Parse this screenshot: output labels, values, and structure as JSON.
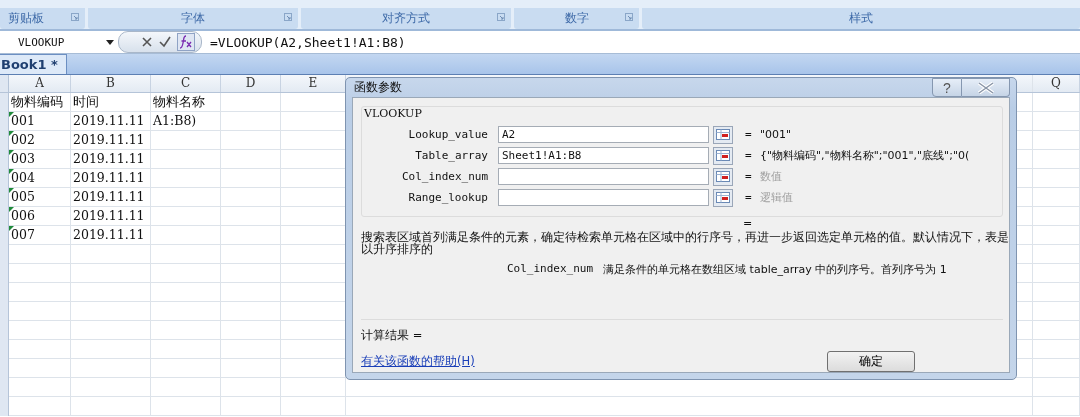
{
  "ribbon": {
    "groups": [
      {
        "label": "剪贴板",
        "launcher": true
      },
      {
        "label": "字体",
        "launcher": true
      },
      {
        "label": "对齐方式",
        "launcher": true
      },
      {
        "label": "数字",
        "launcher": true
      },
      {
        "label": "样式",
        "launcher": false
      }
    ]
  },
  "formula_bar": {
    "name_box": "VLOOKUP",
    "formula": "=VLOOKUP(A2,Sheet1!A1:B8)"
  },
  "workbook_tabs": [
    {
      "label": "Book1 *",
      "selected": true
    }
  ],
  "sheet": {
    "columns": [
      "A",
      "B",
      "C",
      "D",
      "E",
      "Q"
    ],
    "rows": [
      {
        "cells": [
          "物料编码",
          "时间",
          "物料名称"
        ],
        "flagged": false
      },
      {
        "cells": [
          "001",
          "2019.11.11",
          "A1:B8)"
        ],
        "flagged": true
      },
      {
        "cells": [
          "002",
          "2019.11.11"
        ],
        "flagged": true
      },
      {
        "cells": [
          "003",
          "2019.11.11"
        ],
        "flagged": true
      },
      {
        "cells": [
          "004",
          "2019.11.11"
        ],
        "flagged": true
      },
      {
        "cells": [
          "005",
          "2019.11.11"
        ],
        "flagged": true
      },
      {
        "cells": [
          "006",
          "2019.11.11"
        ],
        "flagged": true
      },
      {
        "cells": [
          "007",
          "2019.11.11"
        ],
        "flagged": true
      }
    ]
  },
  "dialog": {
    "title": "函数参数",
    "help_button": "?",
    "function_name": "VLOOKUP",
    "params": [
      {
        "label": "Lookup_value",
        "value": "A2",
        "equals": "=",
        "result": "\"001\"",
        "muted": false
      },
      {
        "label": "Table_array",
        "value": "Sheet1!A1:B8",
        "equals": "=",
        "result": "{\"物料编码\",\"物料名称\";\"001\",\"底线\";\"0(",
        "muted": false
      },
      {
        "label": "Col_index_num",
        "equals": "=",
        "result": "数值",
        "muted": true
      },
      {
        "label": "Range_lookup",
        "equals": "=",
        "result": "逻辑值",
        "muted": true
      }
    ],
    "overall_equals": "=",
    "description": "搜索表区域首列满足条件的元素，确定待检索单元格在区域中的行序号，再进一步返回选定单元格的值。默认情况下，表是以升序排序的",
    "arg_name": "Col_index_num",
    "arg_help": "满足条件的单元格在数组区域 table_array 中的列序号。首列序号为 1",
    "result_label": "计算结果 =",
    "help_link": "有关该函数的帮助(H)",
    "ok_button": "确定"
  }
}
